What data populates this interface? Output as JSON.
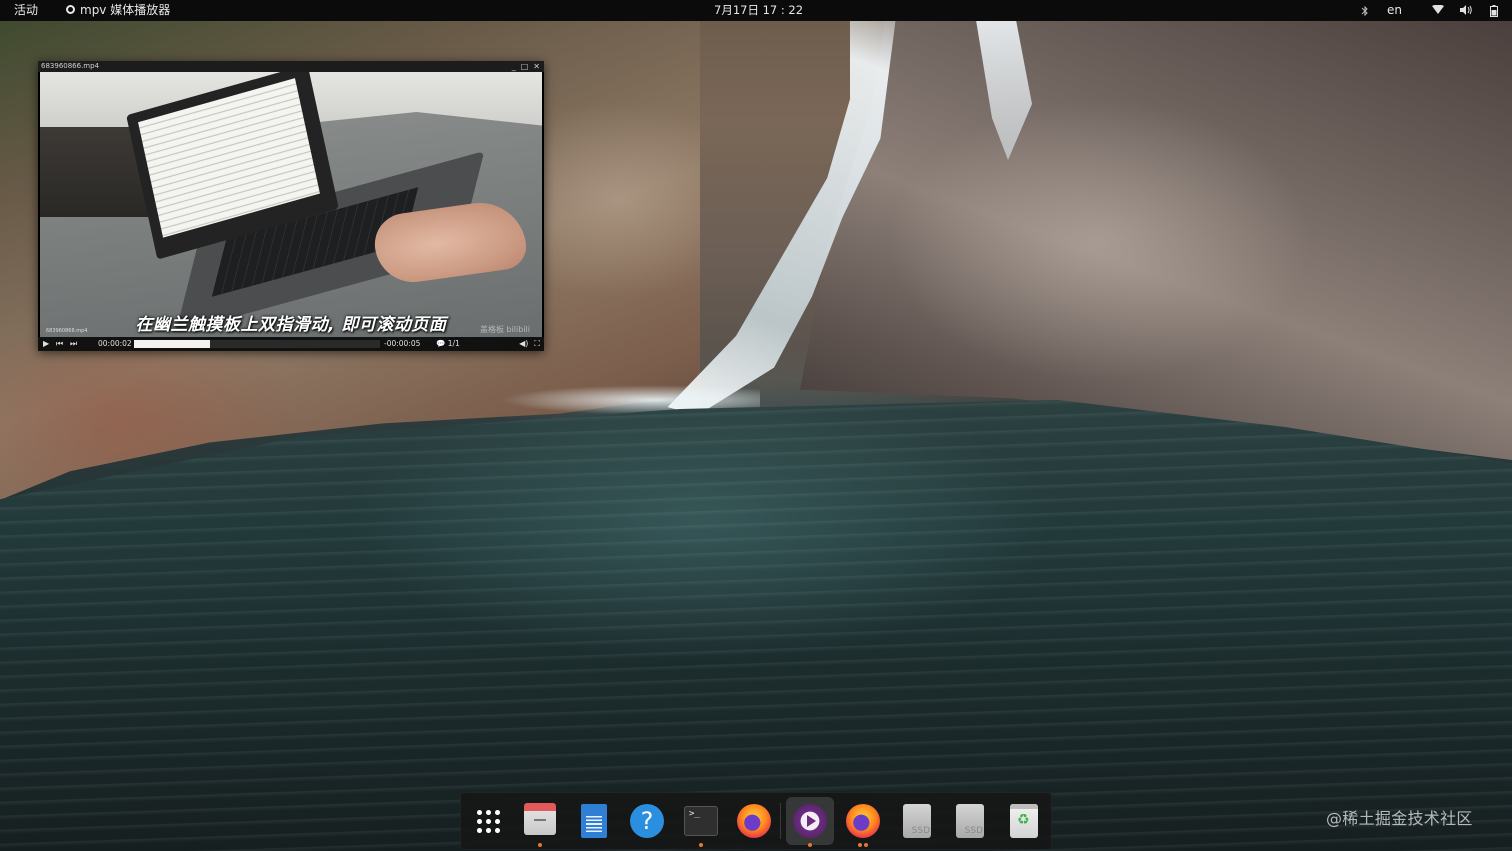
{
  "topbar": {
    "activities": "活动",
    "app_name": "mpv 媒体播放器",
    "clock": "7月17日  17 : 22",
    "language": "en",
    "tray_icons": [
      "bluetooth-icon",
      "wifi-icon",
      "volume-icon",
      "battery-icon"
    ]
  },
  "mpv_window": {
    "title": "683960866.mp4",
    "window_buttons": [
      "_",
      "□",
      "✕"
    ],
    "subtitle": "在幽兰触摸板上双指滑动, 即可滚动页面",
    "osd_title": "683960866.mp4",
    "watermark": "盖格板 bilibili",
    "osc": {
      "time_elapsed": "00:00:02",
      "time_remaining": "-00:00:05",
      "progress_fraction": 0.31,
      "subtitle_track": "1/1"
    }
  },
  "dock": {
    "items": [
      {
        "name": "show-apps",
        "running": false
      },
      {
        "name": "files",
        "running": true
      },
      {
        "name": "text-editor",
        "running": false
      },
      {
        "name": "help",
        "running": false
      },
      {
        "name": "terminal",
        "running": true
      },
      {
        "name": "firefox",
        "running": false
      },
      {
        "name": "mpv",
        "running": true,
        "focused": true
      },
      {
        "name": "firefox-2",
        "running": true
      },
      {
        "name": "ssd-drive-1",
        "running": false
      },
      {
        "name": "ssd-drive-2",
        "running": false
      },
      {
        "name": "trash",
        "running": false
      }
    ],
    "ssd_label": "SSD",
    "help_glyph": "?",
    "terminal_glyph": ">_"
  },
  "watermark_text": "@稀土掘金技术社区",
  "colors": {
    "topbar_bg": "#0b0b0b",
    "running_dot": "#e8762d",
    "dock_bg": "#161616"
  }
}
